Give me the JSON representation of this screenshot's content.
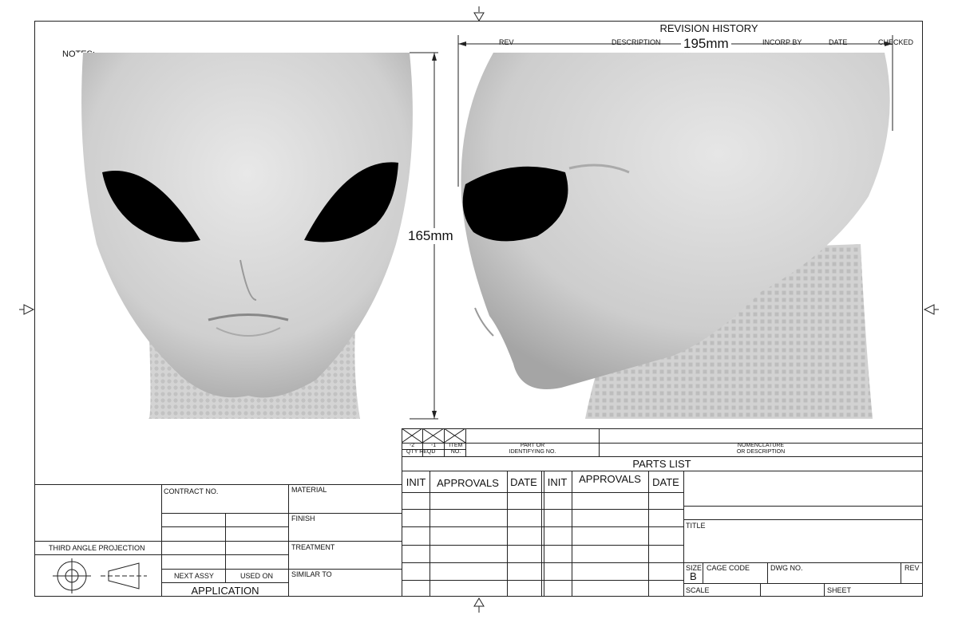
{
  "notes_label": "NOTES:",
  "revision": {
    "title": "REVISION HISTORY",
    "headers": [
      "REV",
      "DESCRIPTION",
      "INCORP BY",
      "DATE",
      "CHECKED"
    ]
  },
  "dimensions": {
    "width": "195mm",
    "height": "165mm"
  },
  "parts_list": {
    "title": "PARTS LIST",
    "qty_cols": [
      "-2",
      "-1"
    ],
    "qty_reqd": "QTY REQD",
    "item_no": "ITEM NO.",
    "part_or": "PART OR",
    "identifying_no": "IDENTIFYING NO.",
    "nomenclature": "NOMENCLATURE",
    "or_description": "OR DESCRIPTION"
  },
  "approvals": {
    "init": "INIT",
    "approvals": "APPROVALS",
    "date": "DATE"
  },
  "left_block": {
    "contract_no": "CONTRACT NO.",
    "material": "MATERIAL",
    "finish": "FINISH",
    "treatment": "TREATMENT",
    "similar_to": "SIMILAR TO",
    "third_angle_projection": "THIRD  ANGLE  PROJECTION",
    "next_assy": "NEXT ASSY",
    "used_on": "USED ON",
    "application": "APPLICATION"
  },
  "title_block": {
    "title": "TITLE",
    "size": "SIZE",
    "size_value": "B",
    "cage_code": "CAGE CODE",
    "dwg_no": "DWG NO.",
    "rev": "REV",
    "scale": "SCALE",
    "sheet": "SHEET"
  },
  "icons": [
    "projection-circle-icon",
    "projection-cone-icon",
    "center-arrow-icon"
  ]
}
